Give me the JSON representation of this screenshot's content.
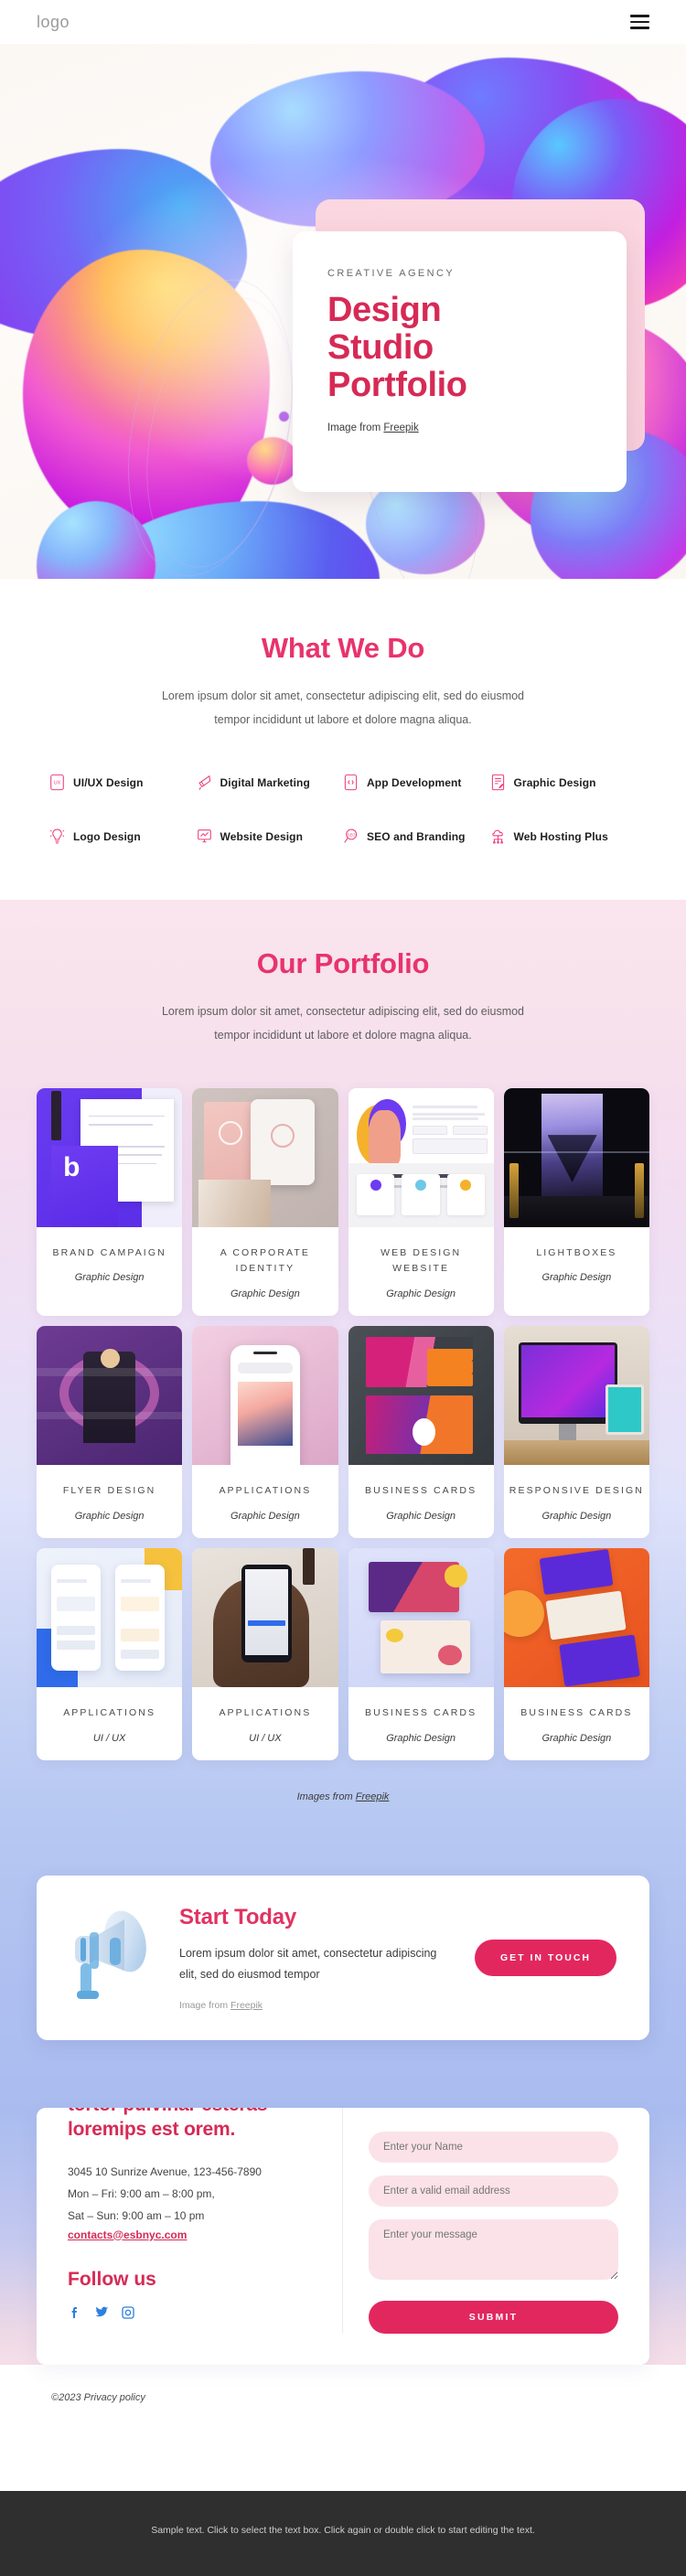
{
  "header": {
    "logo": "logo",
    "menu_icon": "hamburger-icon"
  },
  "hero": {
    "eyebrow": "CREATIVE AGENCY",
    "title_line1": "Design",
    "title_line2": "Studio",
    "title_line3": "Portfolio",
    "credit_prefix": "Image from ",
    "credit_link": "Freepik",
    "accent_color": "#d62a55"
  },
  "services": {
    "title": "What We Do",
    "subtitle": "Lorem ipsum dolor sit amet, consectetur adipiscing elit, sed do eiusmod tempor incididunt ut labore et dolore magna aliqua.",
    "accent_color": "#e8336d",
    "items": [
      {
        "label": "UI/UX Design",
        "icon": "ui-ux-icon"
      },
      {
        "label": "Digital Marketing",
        "icon": "megaphone-icon"
      },
      {
        "label": "App Development",
        "icon": "code-phone-icon"
      },
      {
        "label": "Graphic Design",
        "icon": "document-pen-icon"
      },
      {
        "label": "Logo Design",
        "icon": "lightbulb-icon"
      },
      {
        "label": "Website Design",
        "icon": "monitor-chart-icon"
      },
      {
        "label": "SEO and Branding",
        "icon": "seo-magnifier-icon"
      },
      {
        "label": "Web Hosting Plus",
        "icon": "cloud-server-icon"
      }
    ]
  },
  "portfolio": {
    "title": "Our Portfolio",
    "subtitle": "Lorem ipsum dolor sit amet, consectetur adipiscing elit, sed do eiusmod tempor incididunt ut labore et dolore magna aliqua.",
    "credit_prefix": "Images from ",
    "credit_link": "Freepik",
    "items": [
      {
        "name": "BRAND CAMPAIGN",
        "category": "Graphic Design",
        "thumb": "t-brand"
      },
      {
        "name": "A CORPORATE IDENTITY",
        "category": "Graphic Design",
        "thumb": "t-corp"
      },
      {
        "name": "WEB DESIGN WEBSITE",
        "category": "Graphic Design",
        "thumb": "t-web"
      },
      {
        "name": "LIGHTBOXES",
        "category": "Graphic Design",
        "thumb": "t-light"
      },
      {
        "name": "FLYER DESIGN",
        "category": "Graphic Design",
        "thumb": "t-flyer"
      },
      {
        "name": "APPLICATIONS",
        "category": "Graphic Design",
        "thumb": "t-app"
      },
      {
        "name": "BUSINESS CARDS",
        "category": "Graphic Design",
        "thumb": "t-biz"
      },
      {
        "name": "RESPONSIVE DESIGN",
        "category": "Graphic Design",
        "thumb": "t-resp"
      },
      {
        "name": "APPLICATIONS",
        "category": "UI / UX",
        "thumb": "t-fin"
      },
      {
        "name": "APPLICATIONS",
        "category": "UI / UX",
        "thumb": "t-hand"
      },
      {
        "name": "BUSINESS CARDS",
        "category": "Graphic Design",
        "thumb": "t-bc2"
      },
      {
        "name": "BUSINESS CARDS",
        "category": "Graphic Design",
        "thumb": "t-col"
      }
    ]
  },
  "cta": {
    "title": "Start Today",
    "text": "Lorem ipsum dolor sit amet, consectetur adipiscing elit, sed do eiusmod tempor",
    "credit_prefix": "Image from ",
    "credit_link": "Freepik",
    "button_label": "GET IN TOUCH",
    "button_color": "#e2275f",
    "image": "megaphone-photo"
  },
  "footer": {
    "heading_line1": "tortor pulvinar esteras",
    "heading_line2": "loremips est orem.",
    "address": "3045 10 Sunrize Avenue, 123-456-7890",
    "hours_weekday": "Mon – Fri: 9:00 am – 8:00 pm,",
    "hours_weekend": "Sat – Sun: 9:00 am – 10 pm",
    "email": "contacts@esbnyc.com",
    "follow_title": "Follow us",
    "social": [
      {
        "name": "facebook-icon"
      },
      {
        "name": "twitter-icon"
      },
      {
        "name": "instagram-icon"
      }
    ],
    "form": {
      "name_placeholder": "Enter your Name",
      "email_placeholder": "Enter a valid email address",
      "message_placeholder": "Enter your message",
      "submit_label": "SUBMIT"
    },
    "copyright": "©2023 Privacy policy"
  },
  "bottombar": {
    "text": "Sample text. Click to select the text box. Click again or double click to start editing the text."
  }
}
